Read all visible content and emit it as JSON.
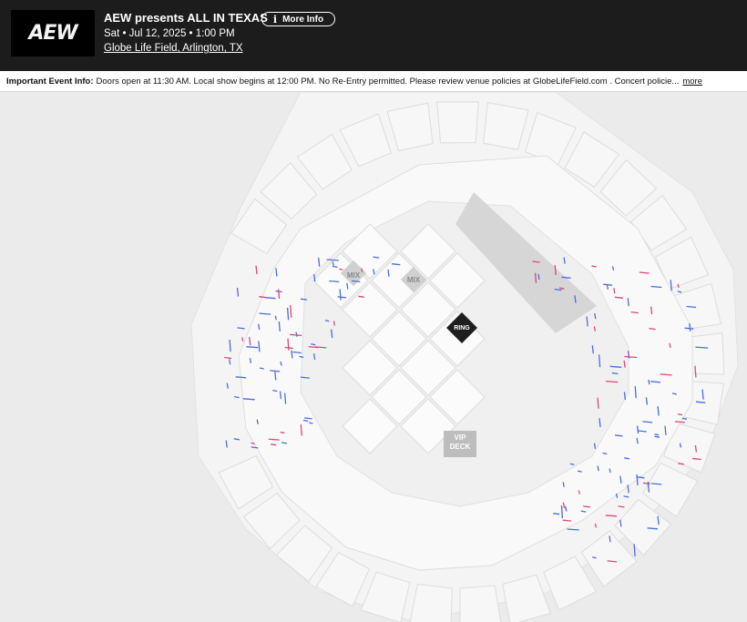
{
  "header": {
    "logo_text": "AEW",
    "title": "AEW presents ALL IN TEXAS",
    "more_info_label": "More Info",
    "date_time": "Sat • Jul 12, 2025 • 1:00 PM",
    "venue": "Globe Life Field, Arlington, TX"
  },
  "info_bar": {
    "label": "Important Event Info:",
    "text": "Doors open at 11:30 AM. Local show begins at 12:00 PM. No Re-Entry permitted. Please review venue policies at GlobeLifeField.com . Concert policie...",
    "more_label": "more"
  },
  "map": {
    "labels": {
      "mix_1": "MIX",
      "mix_2": "MIX",
      "ring": "RING",
      "vip_line1": "VIP",
      "vip_line2": "DECK"
    },
    "colors": {
      "available_standard": "#4a6de0",
      "available_resale": "#e0457a",
      "section": "#f7f7f7",
      "section_stroke": "#dcdcdc",
      "stage": "#d4d4d4",
      "ring": "#1e1e1e",
      "vip": "#bdbdbd"
    }
  }
}
